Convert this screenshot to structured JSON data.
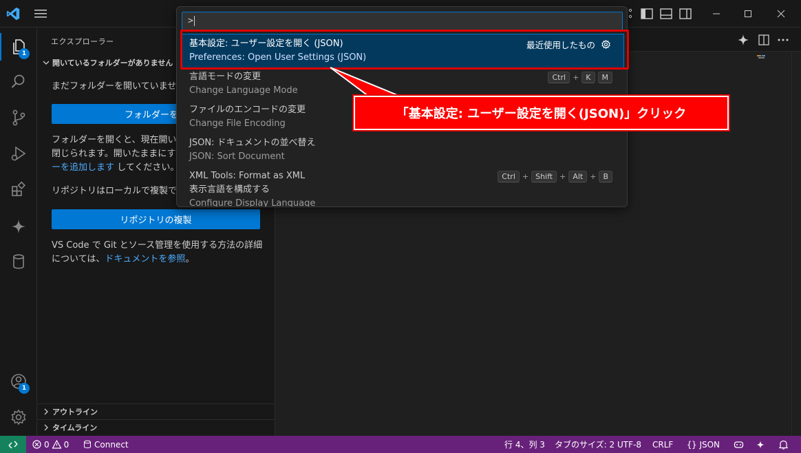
{
  "titlebar": {
    "search_text": ">"
  },
  "activity": {
    "explorer_badge": "1",
    "accounts_badge": "1"
  },
  "sidebar": {
    "title": "エクスプローラー",
    "section_title": "開いているフォルダーがありません",
    "no_folder_text": "まだフォルダーを開いていません。",
    "open_folder_button": "フォルダーを開",
    "para1_line1": "フォルダーを開くと、現在開いてい",
    "para1_line2": "閉じられます。開いたままにするに",
    "para1_line3_link": "ーを追加します",
    "para1_line3_rest": " してください。",
    "repo_text": "リポジトリはローカルで複製できま",
    "clone_button": "リポジトリの複製",
    "git_line1": "VS Code で Git とソース管理を使用する方法の詳細",
    "git_line2_pre": "については、",
    "git_line2_link": "ドキュメントを参照",
    "git_line2_post": "。",
    "outline": "アウトライン",
    "timeline": "タイムライン"
  },
  "quickpick": {
    "input_value": ">",
    "items": [
      {
        "label": "基本設定: ユーザー設定を開く (JSON)",
        "desc": "Preferences: Open User Settings (JSON)",
        "right": "最近使用したもの"
      },
      {
        "label": "言語モードの変更",
        "desc": "Change Language Mode",
        "keys": [
          "Ctrl",
          "K",
          "M"
        ]
      },
      {
        "label": "ファイルのエンコードの変更",
        "desc": "Change File Encoding"
      },
      {
        "label": "JSON: ドキュメントの並べ替え",
        "desc": "JSON: Sort Document"
      },
      {
        "label": "XML Tools: Format as XML",
        "label2": "表示言語を構成する",
        "desc": "Configure Display Language",
        "keys": [
          "Ctrl",
          "Shift",
          "Alt",
          "B"
        ]
      }
    ]
  },
  "callout": {
    "text": "「基本設定: ユーザー設定を開く(JSON)」クリック"
  },
  "statusbar": {
    "errors": "0",
    "warnings": "0",
    "connect": "Connect",
    "position": "行 4、列 3",
    "tab_size": "タブのサイズ: 2",
    "encoding": "UTF-8",
    "eol": "CRLF",
    "language": "JSON"
  },
  "colors": {
    "accent": "#0078d4",
    "statusbar": "#68217a",
    "remote": "#16825d",
    "highlight_red": "#e00000"
  }
}
